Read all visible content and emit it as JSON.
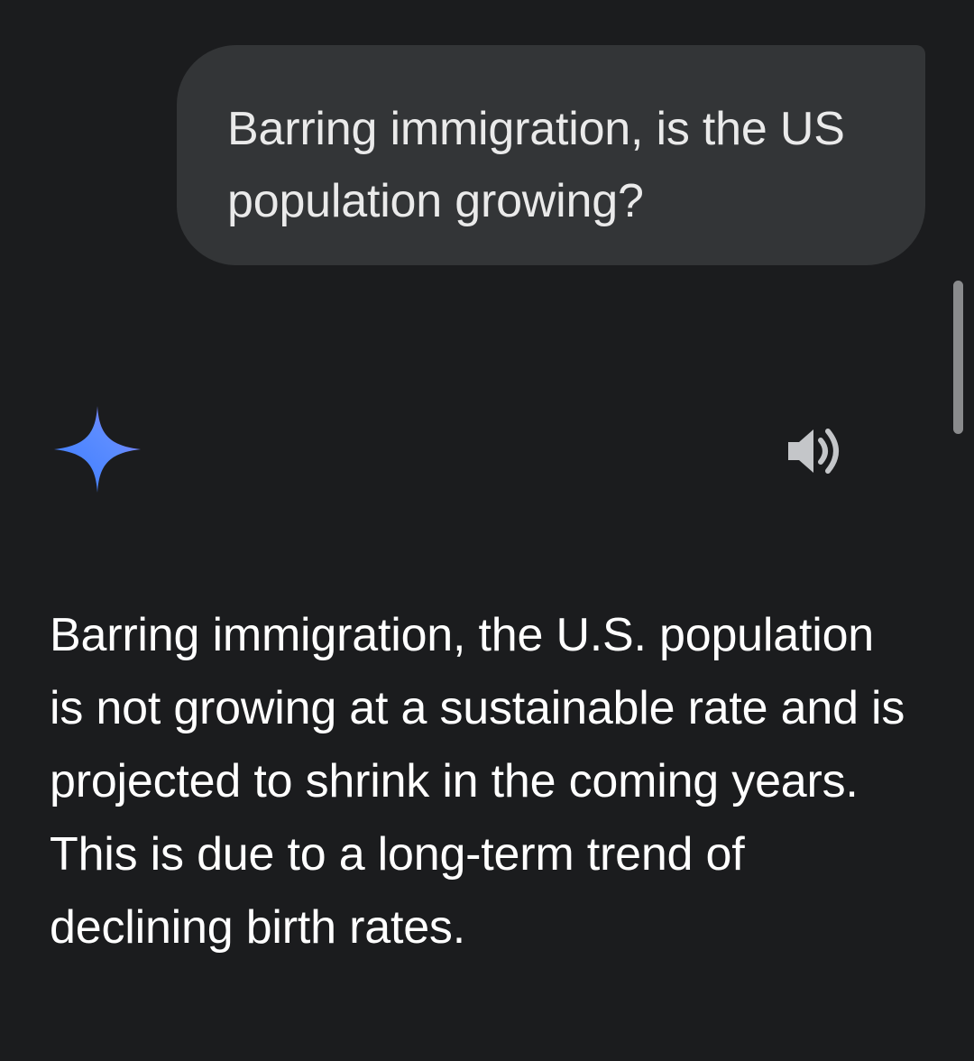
{
  "conversation": {
    "user_message": "Barring immigration, is the US population growing?",
    "response_text": "Barring immigration, the U.S. population is not growing at a sustainable rate and is projected to shrink in the coming years. This is due to a long-term trend of declining birth rates."
  },
  "icons": {
    "assistant": "gemini-spark-icon",
    "read_aloud": "speaker-icon"
  },
  "colors": {
    "background": "#1b1c1e",
    "bubble": "#333537",
    "spark_start": "#4f8cff",
    "spark_end": "#8a6cf7"
  }
}
